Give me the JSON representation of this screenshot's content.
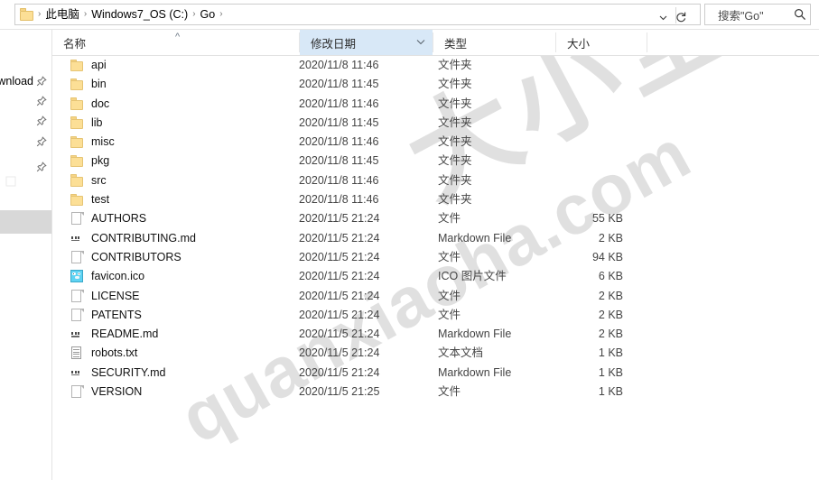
{
  "window": {
    "title": "Go"
  },
  "addressbar": {
    "folder_icon": "folder-icon",
    "crumbs": [
      "此电脑",
      "Windows7_OS (C:)",
      "Go"
    ],
    "separator": "›",
    "dropdown_glyph": "⌄",
    "refresh_glyph": "↻",
    "search": {
      "value": "搜索\"Go\"",
      "placeholder": "搜索\"Go\"",
      "icon": "search-icon"
    }
  },
  "sidebar": {
    "items": [
      {
        "label": "wnload",
        "pin": "pin-icon"
      },
      {
        "label": "",
        "pin": "pin-icon"
      },
      {
        "label": "",
        "pin": "pin-icon"
      },
      {
        "label": "",
        "pin": "pin-icon"
      },
      {
        "label": "",
        "pin": "pin-icon"
      }
    ]
  },
  "columns": {
    "name": {
      "label": "名称",
      "sorted": true,
      "sort_glyph": "^"
    },
    "date": {
      "label": "修改日期",
      "sorted": true,
      "sort_glyph": "⌄"
    },
    "type": {
      "label": "类型"
    },
    "size": {
      "label": "大小"
    }
  },
  "files": [
    {
      "name": "api",
      "icon": "folder-icon",
      "date": "2020/11/8 11:46",
      "type": "文件夹",
      "size": ""
    },
    {
      "name": "bin",
      "icon": "folder-icon",
      "date": "2020/11/8 11:45",
      "type": "文件夹",
      "size": ""
    },
    {
      "name": "doc",
      "icon": "folder-icon",
      "date": "2020/11/8 11:46",
      "type": "文件夹",
      "size": ""
    },
    {
      "name": "lib",
      "icon": "folder-icon",
      "date": "2020/11/8 11:45",
      "type": "文件夹",
      "size": ""
    },
    {
      "name": "misc",
      "icon": "folder-icon",
      "date": "2020/11/8 11:46",
      "type": "文件夹",
      "size": ""
    },
    {
      "name": "pkg",
      "icon": "folder-icon",
      "date": "2020/11/8 11:45",
      "type": "文件夹",
      "size": ""
    },
    {
      "name": "src",
      "icon": "folder-icon",
      "date": "2020/11/8 11:46",
      "type": "文件夹",
      "size": ""
    },
    {
      "name": "test",
      "icon": "folder-icon",
      "date": "2020/11/8 11:46",
      "type": "文件夹",
      "size": ""
    },
    {
      "name": "AUTHORS",
      "icon": "file-icon",
      "date": "2020/11/5 21:24",
      "type": "文件",
      "size": "55 KB"
    },
    {
      "name": "CONTRIBUTING.md",
      "icon": "markdown-icon",
      "date": "2020/11/5 21:24",
      "type": "Markdown File",
      "size": "2 KB"
    },
    {
      "name": "CONTRIBUTORS",
      "icon": "file-icon",
      "date": "2020/11/5 21:24",
      "type": "文件",
      "size": "94 KB"
    },
    {
      "name": "favicon.ico",
      "icon": "ico-image-icon",
      "date": "2020/11/5 21:24",
      "type": "ICO 图片文件",
      "size": "6 KB"
    },
    {
      "name": "LICENSE",
      "icon": "file-icon",
      "date": "2020/11/5 21:24",
      "type": "文件",
      "size": "2 KB"
    },
    {
      "name": "PATENTS",
      "icon": "file-icon",
      "date": "2020/11/5 21:24",
      "type": "文件",
      "size": "2 KB"
    },
    {
      "name": "README.md",
      "icon": "markdown-icon",
      "date": "2020/11/5 21:24",
      "type": "Markdown File",
      "size": "2 KB"
    },
    {
      "name": "robots.txt",
      "icon": "text-doc-icon",
      "date": "2020/11/5 21:24",
      "type": "文本文档",
      "size": "1 KB"
    },
    {
      "name": "SECURITY.md",
      "icon": "markdown-icon",
      "date": "2020/11/5 21:24",
      "type": "Markdown File",
      "size": "1 KB"
    },
    {
      "name": "VERSION",
      "icon": "file-icon",
      "date": "2020/11/5 21:25",
      "type": "文件",
      "size": "1 KB"
    }
  ],
  "watermark": {
    "chinese": "大小全教程",
    "url": "quanxiaoha.com"
  },
  "colors": {
    "sorted_header": "#d8e8f7",
    "folder": "#fcdf96",
    "scrollbar": "#d8d8d8"
  }
}
